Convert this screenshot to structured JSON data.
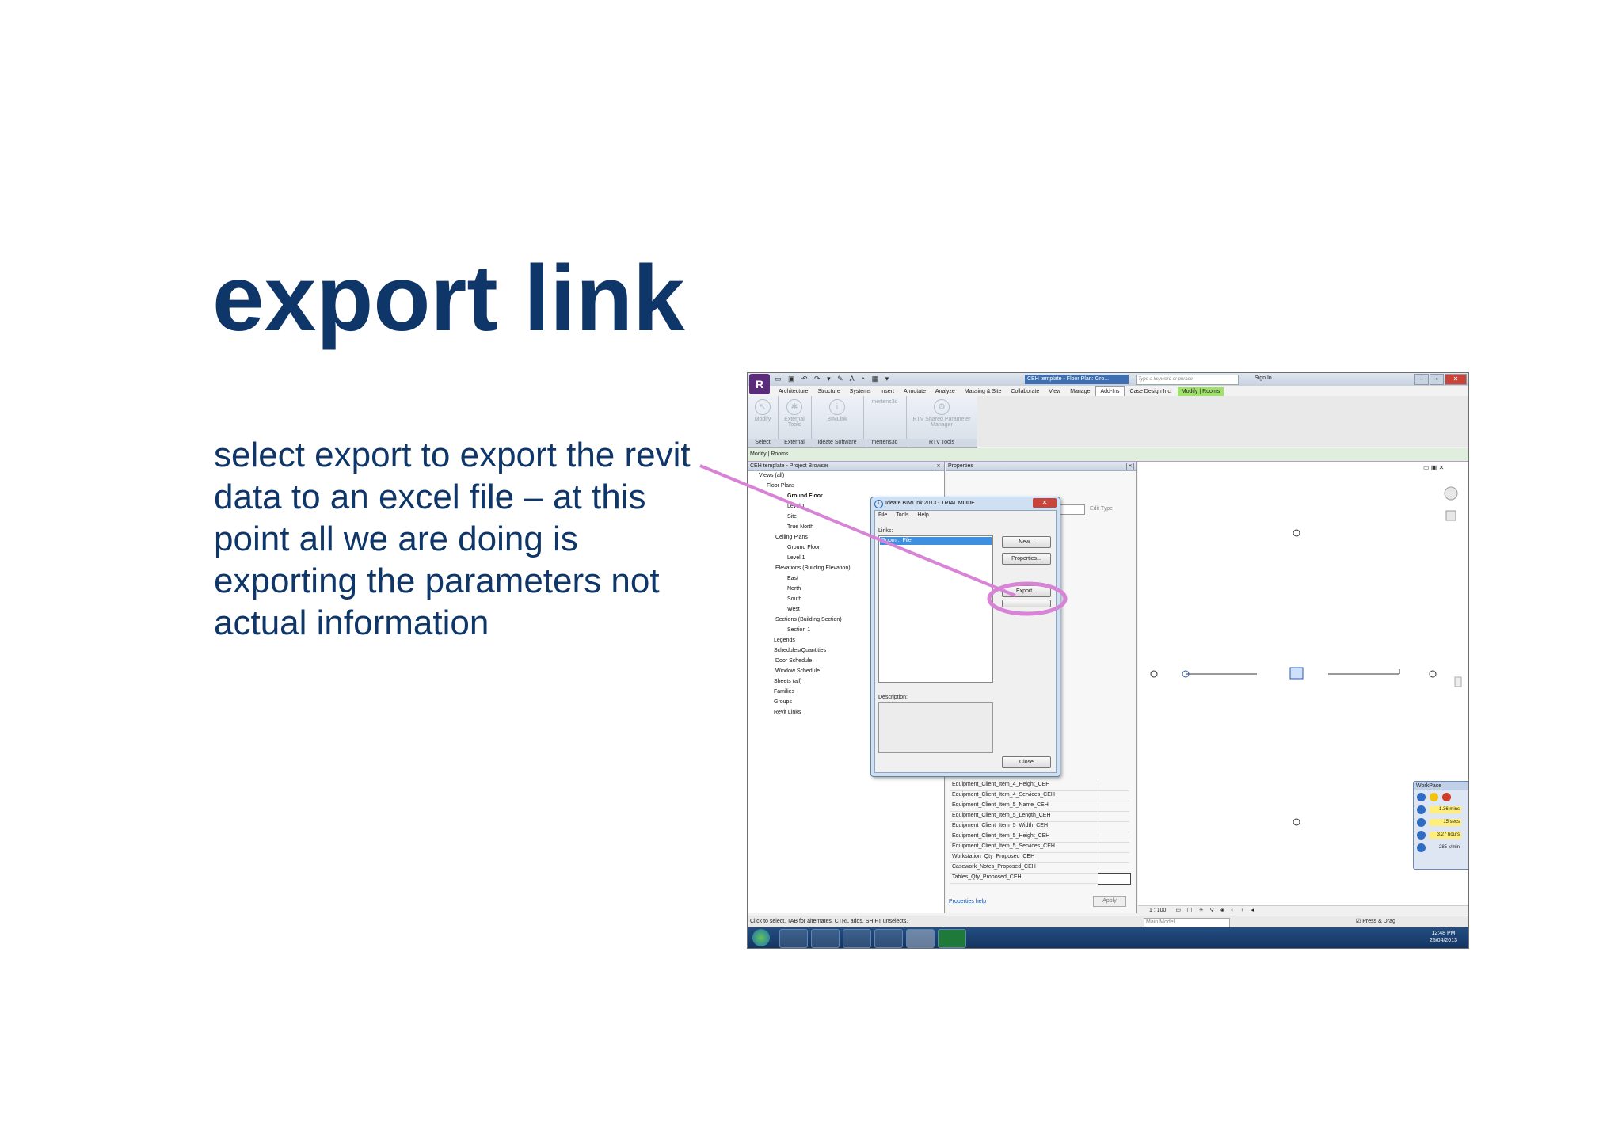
{
  "slide": {
    "title": "export link",
    "body_lines": [
      "select export to export the revit",
      "data to an excel file – at this",
      "point all we are doing is",
      "exporting the parameters not",
      "actual information"
    ]
  },
  "revit": {
    "window_title": "CEH template - Floor Plan: Gro...",
    "search_placeholder": "Type a keyword or phrase",
    "sign_in": "Sign In",
    "tabs": [
      "Architecture",
      "Structure",
      "Systems",
      "Insert",
      "Annotate",
      "Analyze",
      "Massing & Site",
      "Collaborate",
      "View",
      "Manage",
      "Add-Ins",
      "Case Design Inc.",
      "Modify | Rooms"
    ],
    "ribbon_groups": [
      {
        "button": "Modify",
        "label": "Select"
      },
      {
        "button": "External Tools",
        "label": "External"
      },
      {
        "button": "BIMLink",
        "label": "Ideate Software"
      },
      {
        "button": "mertens3d",
        "label": "mertens3d"
      },
      {
        "button": "RTV Shared Parameter Manager",
        "label": "RTV Tools"
      }
    ],
    "context_bar": "Modify | Rooms",
    "project_browser": {
      "title": "CEH template - Project Browser",
      "items": [
        "Views (all)",
        "Floor Plans",
        "Ground Floor",
        "Level 1",
        "Site",
        "True North",
        "Ceiling Plans",
        "Ground Floor",
        "Level 1",
        "Elevations (Building Elevation)",
        "East",
        "North",
        "South",
        "West",
        "Sections (Building Section)",
        "Section 1",
        "Legends",
        "Schedules/Quantities",
        "Door Schedule",
        "Window Schedule",
        "Sheets (all)",
        "Families",
        "Groups",
        "Revit Links"
      ]
    },
    "properties": {
      "title": "Properties",
      "edit_type": "Edit Type",
      "rows": [
        "Equipment_Client_Item_4_Height_CEH",
        "Equipment_Client_Item_4_Services_CEH",
        "Equipment_Client_Item_5_Name_CEH",
        "Equipment_Client_Item_5_Length_CEH",
        "Equipment_Client_Item_5_Width_CEH",
        "Equipment_Client_Item_5_Height_CEH",
        "Equipment_Client_Item_5_Services_CEH",
        "Workstation_Qty_Proposed_CEH",
        "Casework_Notes_Proposed_CEH",
        "Tables_Qty_Proposed_CEH"
      ],
      "help": "Properties help",
      "apply": "Apply"
    },
    "dialog": {
      "title": "Ideate BIMLink 2013 - TRIAL MODE",
      "menu": [
        "File",
        "Tools",
        "Help"
      ],
      "links_label": "Links:",
      "selected_link": "Room... File",
      "buttons": [
        "New...",
        "Properties...",
        "Export...",
        "",
        "Close"
      ],
      "description_label": "Description:"
    },
    "workpace": {
      "title": "WorkPace",
      "values": [
        "1.36 mins",
        "15 secs",
        "3.27 hours",
        "285 k/min"
      ]
    },
    "view_scale": "1 : 100",
    "status_hint": "Click to select, TAB for alternates, CTRL adds, SHIFT unselects.",
    "model": "Main Model",
    "press_drag": "Press & Drag",
    "clock_time": "12:48 PM",
    "clock_date": "25/04/2013",
    "colors": {
      "title_text": "#0e3668",
      "annotation": "#d884d6"
    }
  }
}
